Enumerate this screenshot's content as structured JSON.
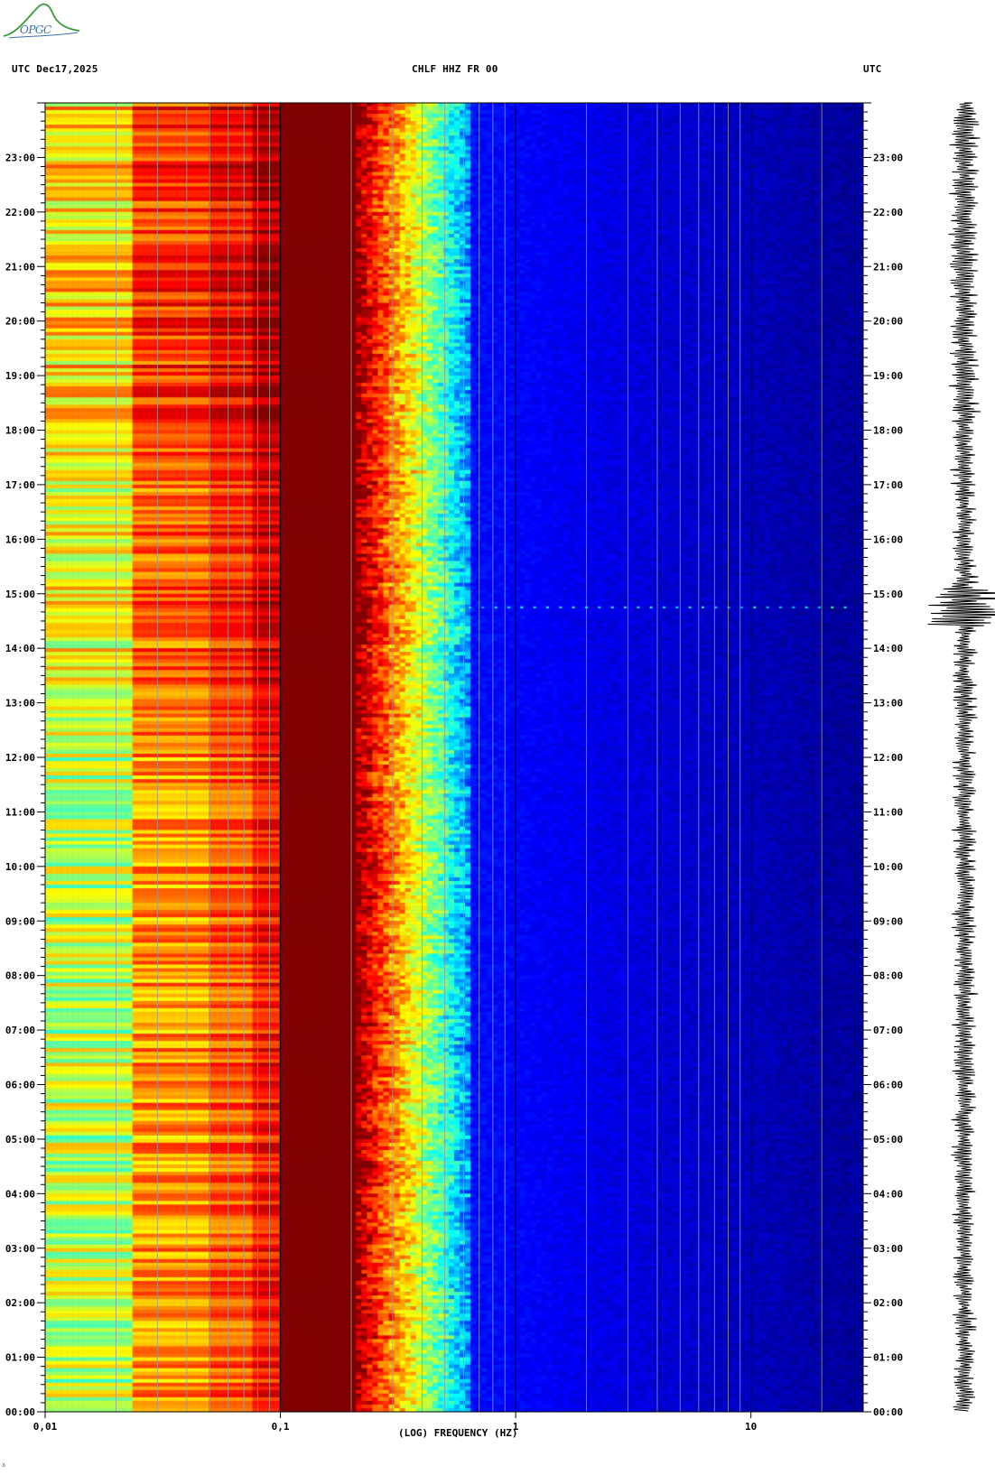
{
  "header": {
    "left": "UTC  Dec17,2025",
    "center": "CHLF HHZ FR 00",
    "right": "UTC"
  },
  "logo": {
    "text": "OPGC"
  },
  "corner_mark": "ᐞ",
  "colors": {
    "low": "#00007f",
    "mid": "#00ffff",
    "high": "#ffff00",
    "peak": "#7f0000"
  },
  "chart_data": {
    "type": "heatmap",
    "title": "",
    "xlabel": "(LOG) FREQUENCY (HZ)",
    "ylabel": "UTC",
    "x_scale": "log",
    "xlim": [
      0.01,
      30
    ],
    "x_ticks": [
      {
        "value": 0.01,
        "label": "0,01"
      },
      {
        "value": 0.1,
        "label": "0,1"
      },
      {
        "value": 1,
        "label": "1"
      },
      {
        "value": 10,
        "label": "10"
      }
    ],
    "y_range_hours": [
      0,
      24
    ],
    "y_ticks": [
      "00:00",
      "01:00",
      "02:00",
      "03:00",
      "04:00",
      "05:00",
      "06:00",
      "07:00",
      "08:00",
      "09:00",
      "10:00",
      "11:00",
      "12:00",
      "13:00",
      "14:00",
      "15:00",
      "16:00",
      "17:00",
      "18:00",
      "19:00",
      "20:00",
      "21:00",
      "22:00",
      "23:00"
    ],
    "colormap": "jet",
    "dominant_energy_band_hz": [
      0.1,
      0.2
    ],
    "events_utc_hour": [
      14.75
    ]
  }
}
